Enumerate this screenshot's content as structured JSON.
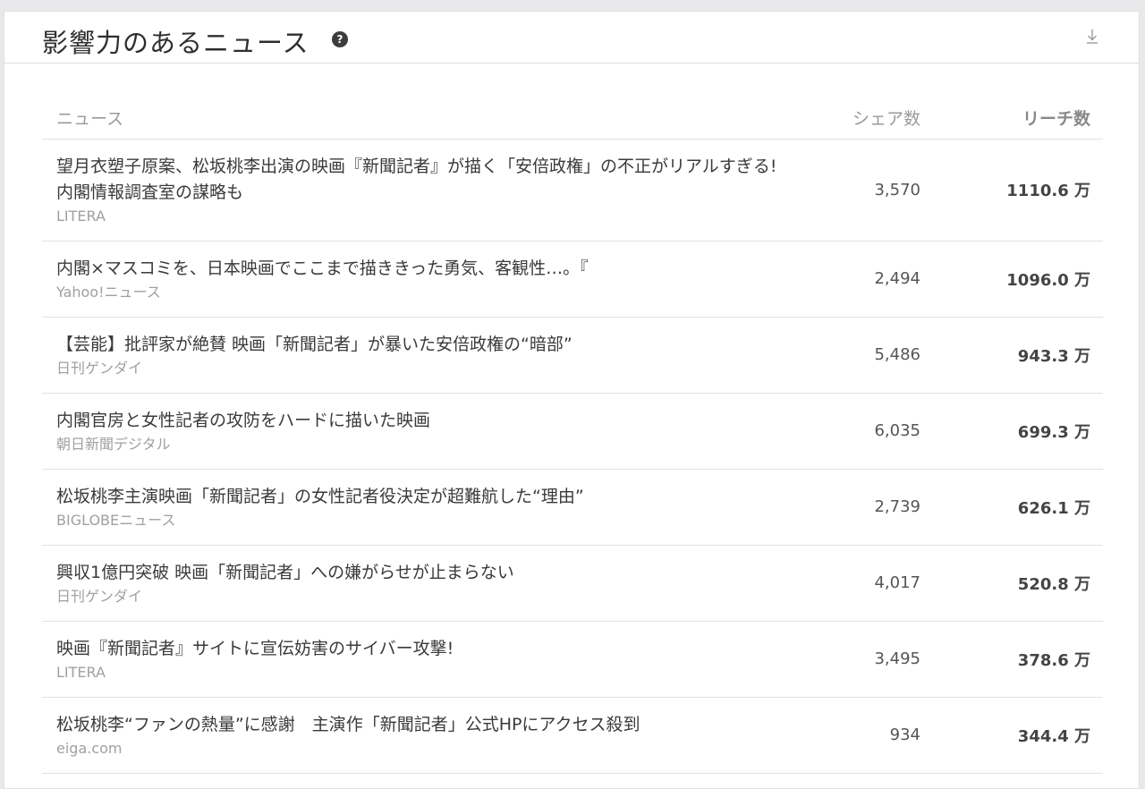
{
  "panel": {
    "title": "影響力のあるニュース",
    "help_glyph": "?",
    "help_icon": "question-circle-icon",
    "download_icon": "download-icon"
  },
  "columns": {
    "news": "ニュース",
    "share": "シェア数",
    "reach": "リーチ数"
  },
  "rows": [
    {
      "headline": "望月衣塑子原案、松坂桃李出演の映画『新聞記者』が描く「安倍政権」の不正がリアルすぎる! 内閣情報調査室の謀略も",
      "source": "LITERA",
      "share": "3,570",
      "reach": "1110.6 万"
    },
    {
      "headline": "内閣×マスコミを、日本映画でここまで描ききった勇気、客観性…。『",
      "source": "Yahoo!ニュース",
      "share": "2,494",
      "reach": "1096.0 万"
    },
    {
      "headline": "【芸能】批評家が絶賛 映画「新聞記者」が暴いた安倍政権の“暗部”",
      "source": "日刊ゲンダイ",
      "share": "5,486",
      "reach": "943.3 万"
    },
    {
      "headline": "内閣官房と女性記者の攻防をハードに描いた映画",
      "source": "朝日新聞デジタル",
      "share": "6,035",
      "reach": "699.3 万"
    },
    {
      "headline": "松坂桃李主演映画「新聞記者」の女性記者役決定が超難航した“理由”",
      "source": "BIGLOBEニュース",
      "share": "2,739",
      "reach": "626.1 万"
    },
    {
      "headline": "興収1億円突破 映画「新聞記者」への嫌がらせが止まらない",
      "source": "日刊ゲンダイ",
      "share": "4,017",
      "reach": "520.8 万"
    },
    {
      "headline": "映画『新聞記者』サイトに宣伝妨害のサイバー攻撃!",
      "source": "LITERA",
      "share": "3,495",
      "reach": "378.6 万"
    },
    {
      "headline": "松坂桃李“ファンの熱量”に感謝　主演作「新聞記者」公式HPにアクセス殺到",
      "source": "eiga.com",
      "share": "934",
      "reach": "344.4 万"
    }
  ]
}
